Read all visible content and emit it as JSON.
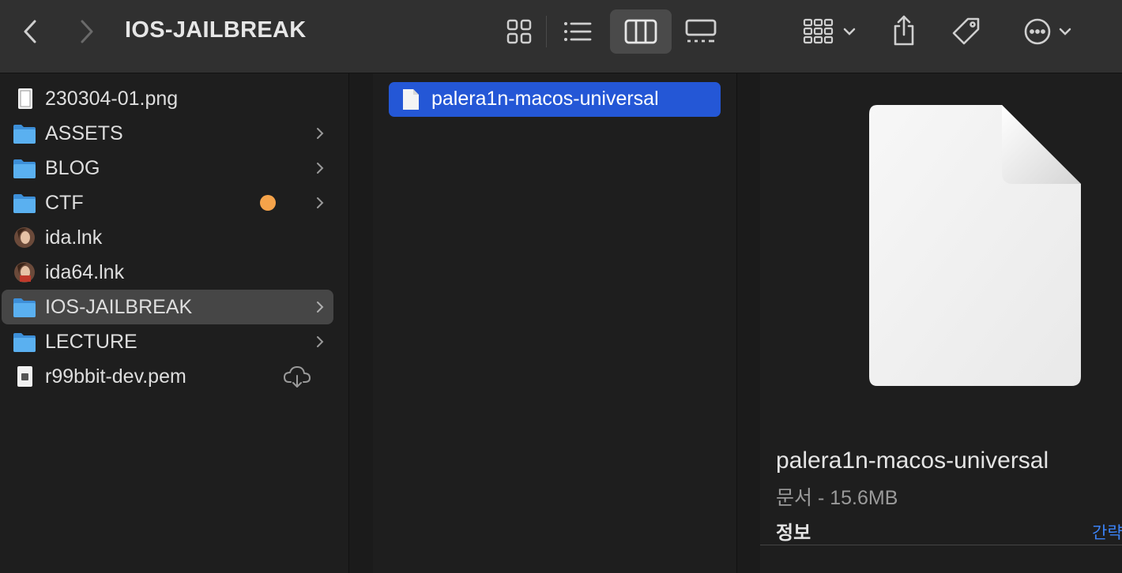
{
  "toolbar": {
    "title": "IOS-JAILBREAK",
    "back": "back-icon",
    "forward": "forward-icon",
    "views": [
      "icon-view",
      "list-view",
      "column-view",
      "gallery-view"
    ],
    "active_view": "column-view"
  },
  "sidebar": {
    "items": [
      {
        "label": "230304-01.png",
        "type": "image"
      },
      {
        "label": "ASSETS",
        "type": "folder"
      },
      {
        "label": "BLOG",
        "type": "folder"
      },
      {
        "label": "CTF",
        "type": "folder",
        "tag_color": "#f5a34a"
      },
      {
        "label": "ida.lnk",
        "type": "shortcut"
      },
      {
        "label": "ida64.lnk",
        "type": "shortcut"
      },
      {
        "label": "IOS-JAILBREAK",
        "type": "folder",
        "selected": true
      },
      {
        "label": "LECTURE",
        "type": "folder"
      },
      {
        "label": "r99bbit-dev.pem",
        "type": "certificate",
        "cloud": true
      }
    ]
  },
  "column2": {
    "selected_file": "palera1n-macos-universal"
  },
  "preview": {
    "name": "palera1n-macos-universal",
    "meta": "문서 - 15.6MB",
    "info_heading": "정보",
    "more_link": "간략"
  },
  "colors": {
    "selection": "#2457d6",
    "folder": "#5ab0f0",
    "link": "#3b82f6"
  }
}
